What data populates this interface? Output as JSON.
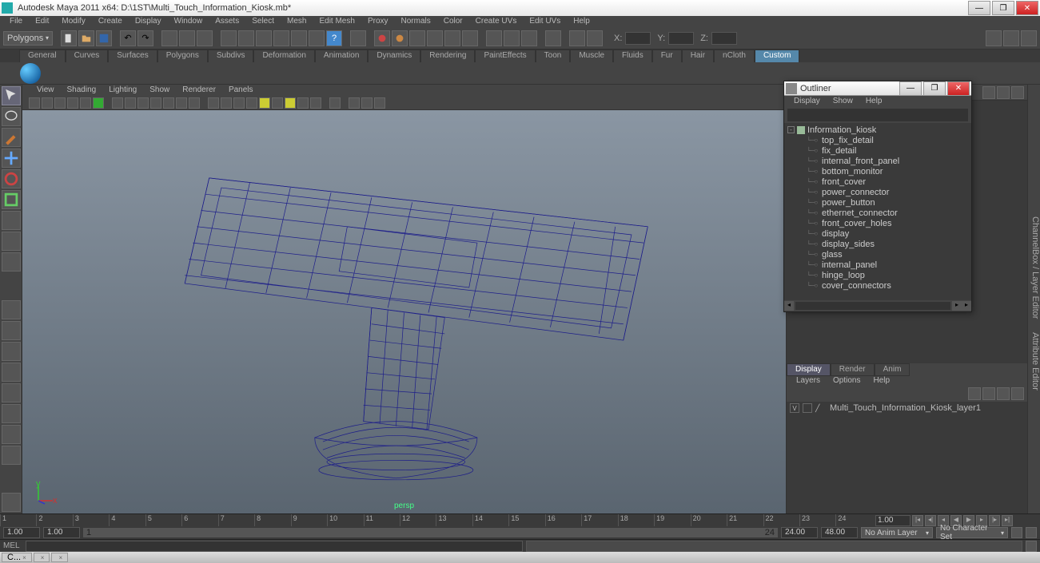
{
  "window": {
    "title": "Autodesk Maya 2011 x64: D:\\1ST\\Multi_Touch_Information_Kiosk.mb*",
    "buttons": {
      "min": "—",
      "max": "❐",
      "close": "✕"
    }
  },
  "menubar": [
    "File",
    "Edit",
    "Modify",
    "Create",
    "Display",
    "Window",
    "Assets",
    "Select",
    "Mesh",
    "Edit Mesh",
    "Proxy",
    "Normals",
    "Color",
    "Create UVs",
    "Edit UVs",
    "Help"
  ],
  "mode_selector": "Polygons",
  "coords": {
    "x_label": "X:",
    "y_label": "Y:",
    "z_label": "Z:"
  },
  "shelf_tabs": [
    "General",
    "Curves",
    "Surfaces",
    "Polygons",
    "Subdivs",
    "Deformation",
    "Animation",
    "Dynamics",
    "Rendering",
    "PaintEffects",
    "Toon",
    "Muscle",
    "Fluids",
    "Fur",
    "Hair",
    "nCloth",
    "Custom"
  ],
  "shelf_active": "Custom",
  "viewport_menu": [
    "View",
    "Shading",
    "Lighting",
    "Show",
    "Renderer",
    "Panels"
  ],
  "viewport_label": "persp",
  "axis": {
    "y": "y",
    "x": "x",
    "z": "z"
  },
  "outliner": {
    "title": "Outliner",
    "menu": [
      "Display",
      "Show",
      "Help"
    ],
    "root": "Information_kiosk",
    "children": [
      "top_fix_detail",
      "fix_detail",
      "internal_front_panel",
      "bottom_monitor",
      "front_cover",
      "power_connector",
      "power_button",
      "ethernet_connector",
      "front_cover_holes",
      "display",
      "display_sides",
      "glass",
      "internal_panel",
      "hinge_loop",
      "cover_connectors"
    ]
  },
  "rightside_tabs": [
    "ChannelBox / Layer Editor",
    "Attribute Editor"
  ],
  "layer_tabs": [
    "Display",
    "Render",
    "Anim"
  ],
  "layer_menu": [
    "Layers",
    "Options",
    "Help"
  ],
  "layers": [
    {
      "vis": "V",
      "name": "Multi_Touch_Information_Kiosk_layer1"
    }
  ],
  "timeline": {
    "ticks": [
      "1",
      "2",
      "3",
      "4",
      "5",
      "6",
      "7",
      "8",
      "9",
      "10",
      "11",
      "12",
      "13",
      "14",
      "15",
      "16",
      "17",
      "18",
      "19",
      "20",
      "21",
      "22",
      "23",
      "24"
    ],
    "current": "1.00",
    "range_start": "1.00",
    "range_end_in": "1.00",
    "slider_start": "1",
    "slider_end": "24",
    "range_end": "24.00",
    "range_out": "48.00",
    "anim_layer": "No Anim Layer",
    "char_set": "No Character Set"
  },
  "cmd_label": "MEL",
  "taskbar": [
    "C...",
    "",
    ""
  ]
}
